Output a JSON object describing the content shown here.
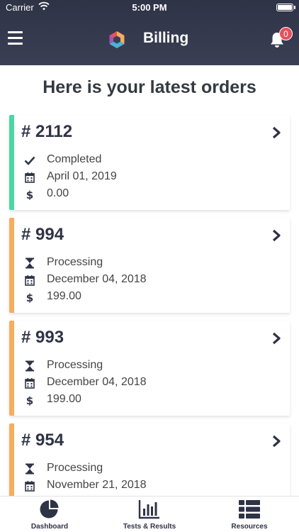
{
  "status_bar": {
    "carrier": "Carrier",
    "time": "5:00 PM"
  },
  "header": {
    "title": "Billing",
    "notification_count": "0"
  },
  "page_title": "Here is your latest orders",
  "orders": [
    {
      "number": "# 2112",
      "status": "Completed",
      "date": "April 01, 2019",
      "amount": "0.00"
    },
    {
      "number": "# 994",
      "status": "Processing",
      "date": "December 04, 2018",
      "amount": "199.00"
    },
    {
      "number": "# 993",
      "status": "Processing",
      "date": "December 04, 2018",
      "amount": "199.00"
    },
    {
      "number": "# 954",
      "status": "Processing",
      "date": "November 21, 2018",
      "amount": ""
    }
  ],
  "tabs": [
    {
      "label": "Dashboard",
      "icon": "pie-chart-icon"
    },
    {
      "label": "Tests & Results",
      "icon": "bar-chart-icon"
    },
    {
      "label": "Resources",
      "icon": "list-icon"
    }
  ],
  "colors": {
    "header": "#2f3346",
    "completed": "#4cd6a6",
    "processing": "#f6ad5f",
    "badge": "#e8505b"
  }
}
